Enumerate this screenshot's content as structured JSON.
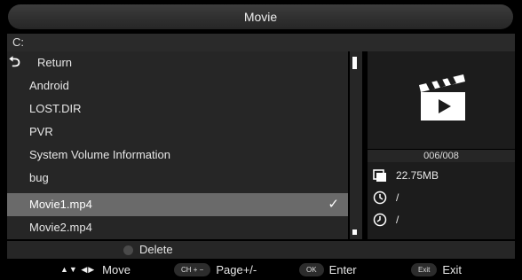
{
  "header": {
    "title": "Movie"
  },
  "path": {
    "label": "C:"
  },
  "file_list": {
    "return_label": "Return",
    "items": [
      {
        "label": "Android"
      },
      {
        "label": "LOST.DIR"
      },
      {
        "label": "PVR"
      },
      {
        "label": "System Volume Information"
      },
      {
        "label": "bug"
      },
      {
        "label": "Movie1.mp4",
        "selected": true
      },
      {
        "label": "Movie2.mp4"
      }
    ],
    "check_glyph": "✓"
  },
  "preview": {
    "icon": "clapperboard-play-icon",
    "counter": "006/008"
  },
  "info": {
    "size": "22.75MB",
    "time1": "/",
    "time2": "/"
  },
  "action_bar": {
    "delete_label": "Delete",
    "delete_color": "#4a4a4a"
  },
  "help_bar": {
    "move_keys": "▲▼ ◀▶",
    "move_label": "Move",
    "page_key": "CH + −",
    "page_label": "Page+/-",
    "enter_key": "OK",
    "enter_label": "Enter",
    "exit_key": "Exit",
    "exit_label": "Exit"
  },
  "colors": {
    "selected_row": "#6a6a6a",
    "panel": "#262626",
    "background": "#000000"
  }
}
